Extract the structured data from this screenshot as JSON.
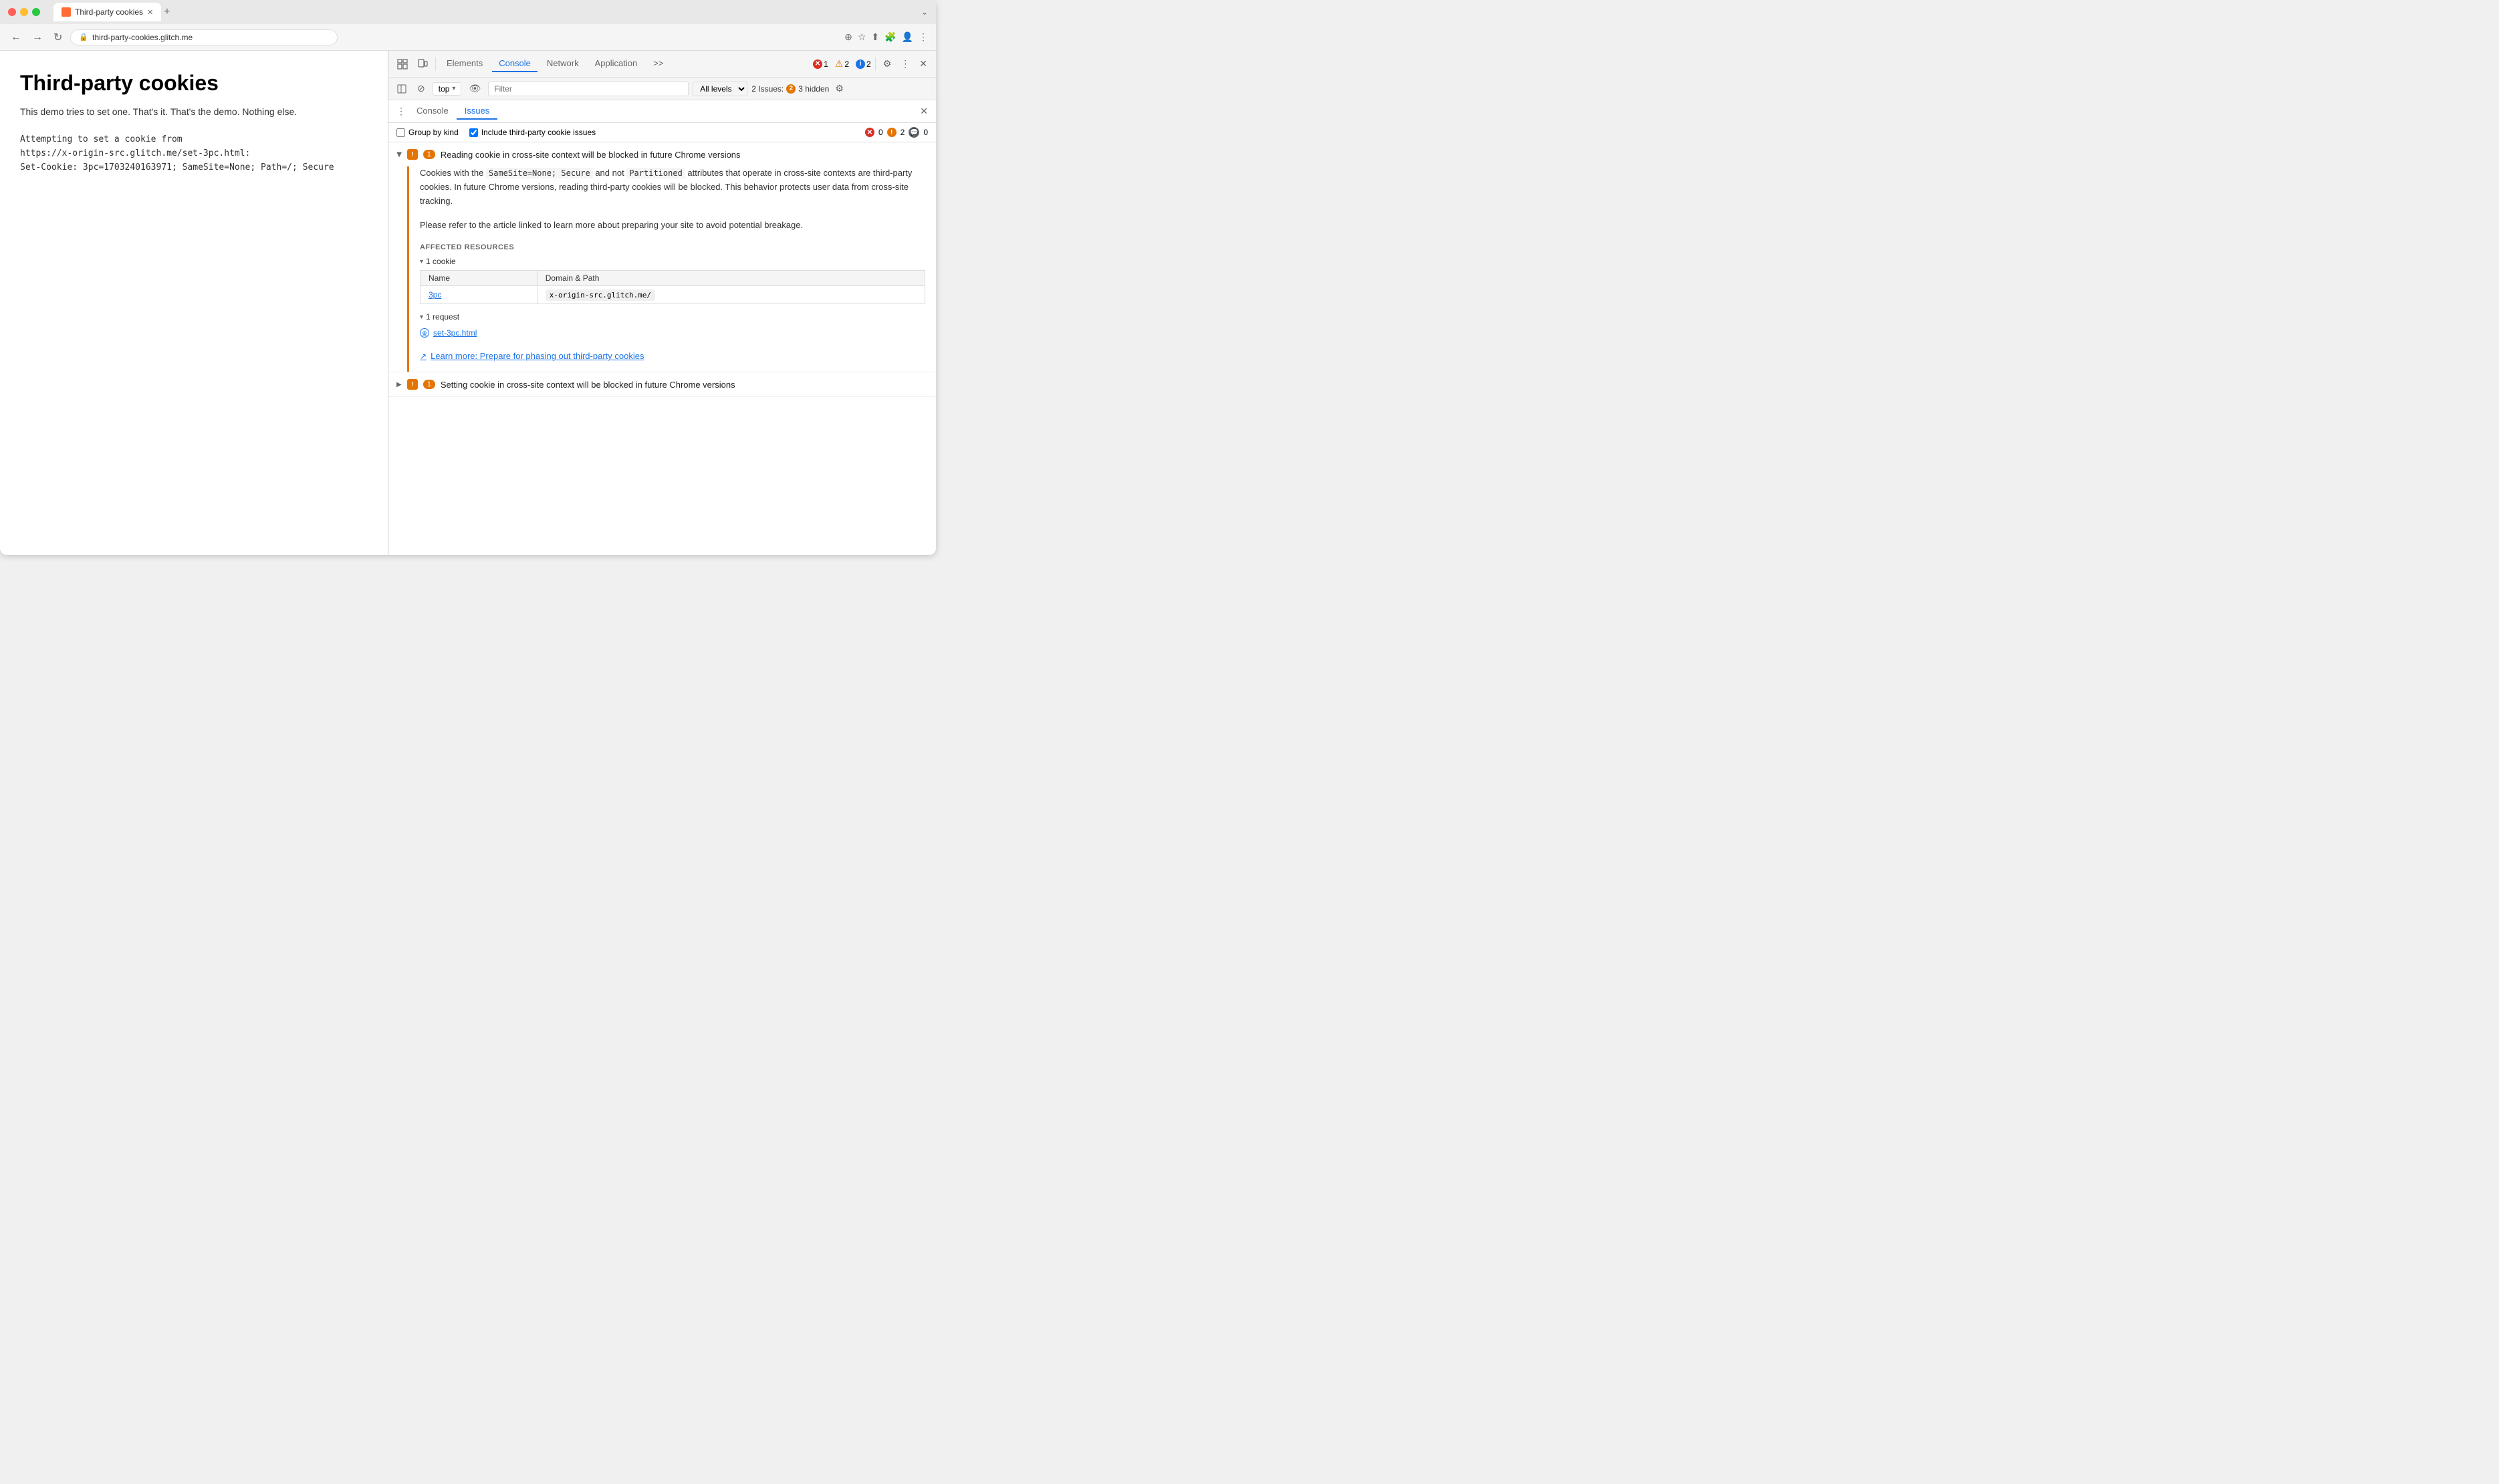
{
  "browser": {
    "title": "Third-party cookies",
    "tab_label": "Third-party cookies",
    "url": "third-party-cookies.glitch.me",
    "close_icon": "✕",
    "add_tab_icon": "+",
    "back_icon": "←",
    "forward_icon": "→",
    "refresh_icon": "↻",
    "zoom_icon": "⊕",
    "star_icon": "☆",
    "share_icon": "⬆",
    "menu_icon": "⋮",
    "collapse_icon": "⌄"
  },
  "devtools": {
    "tabs": [
      {
        "label": "Elements",
        "active": false
      },
      {
        "label": "Console",
        "active": false
      },
      {
        "label": "Network",
        "active": false
      },
      {
        "label": "Application",
        "active": false
      }
    ],
    "more_tabs": ">>",
    "error_count": "1",
    "warn_count": "2",
    "info_count": "2",
    "settings_icon": "⚙",
    "more_icon": "⋮",
    "close_icon": "✕",
    "console_toolbar": {
      "layout_icon": "▣",
      "no_entry_icon": "⊘",
      "top_label": "top",
      "eye_icon": "👁",
      "filter_placeholder": "Filter",
      "levels_label": "All levels",
      "levels_arrow": "▾",
      "issues_label": "2 Issues:",
      "issues_warn": "2",
      "hidden_label": "3 hidden",
      "settings_icon": "⚙"
    }
  },
  "issues_panel": {
    "menu_icon": "⋮",
    "tabs": [
      {
        "label": "Console",
        "active": false
      },
      {
        "label": "Issues",
        "active": true
      }
    ],
    "close_icon": "✕",
    "options": {
      "group_by_kind_label": "Group by kind",
      "include_third_party_label": "Include third-party cookie issues",
      "include_third_party_checked": true,
      "error_count": "0",
      "warn_count": "2",
      "comment_count": "0"
    },
    "issues": [
      {
        "id": "issue-1",
        "expanded": true,
        "count": "1",
        "title": "Reading cookie in cross-site context will be blocked in future Chrome versions",
        "description_parts": [
          "Cookies with the ",
          "SameSite=None; Secure",
          " and not ",
          "Partitioned",
          " attributes that operate in cross-site contexts are third-party cookies. In future Chrome versions, reading third-party cookies will be blocked. This behavior protects user data from cross-site tracking."
        ],
        "description_2": "Please refer to the article linked to learn more about preparing your site to avoid potential breakage.",
        "affected_resources_label": "AFFECTED RESOURCES",
        "cookie_section": {
          "label": "1 cookie",
          "table_headers": [
            "Name",
            "Domain & Path"
          ],
          "rows": [
            {
              "name": "3pc",
              "domain": "x-origin-src.glitch.me/"
            }
          ]
        },
        "request_section": {
          "label": "1 request",
          "items": [
            {
              "label": "set-3pc.html"
            }
          ]
        },
        "learn_more_label": "Learn more: Prepare for phasing out third-party cookies",
        "learn_more_url": "#"
      },
      {
        "id": "issue-2",
        "expanded": false,
        "count": "1",
        "title": "Setting cookie in cross-site context will be blocked in future Chrome versions"
      }
    ]
  },
  "page": {
    "title": "Third-party cookies",
    "description": "This demo tries to set one. That's it. That's the demo. Nothing else.",
    "code_lines": [
      "Attempting to set a cookie from",
      "https://x-origin-src.glitch.me/set-3pc.html:",
      "Set-Cookie: 3pc=1703240163971; SameSite=None; Path=/; Secure"
    ]
  }
}
